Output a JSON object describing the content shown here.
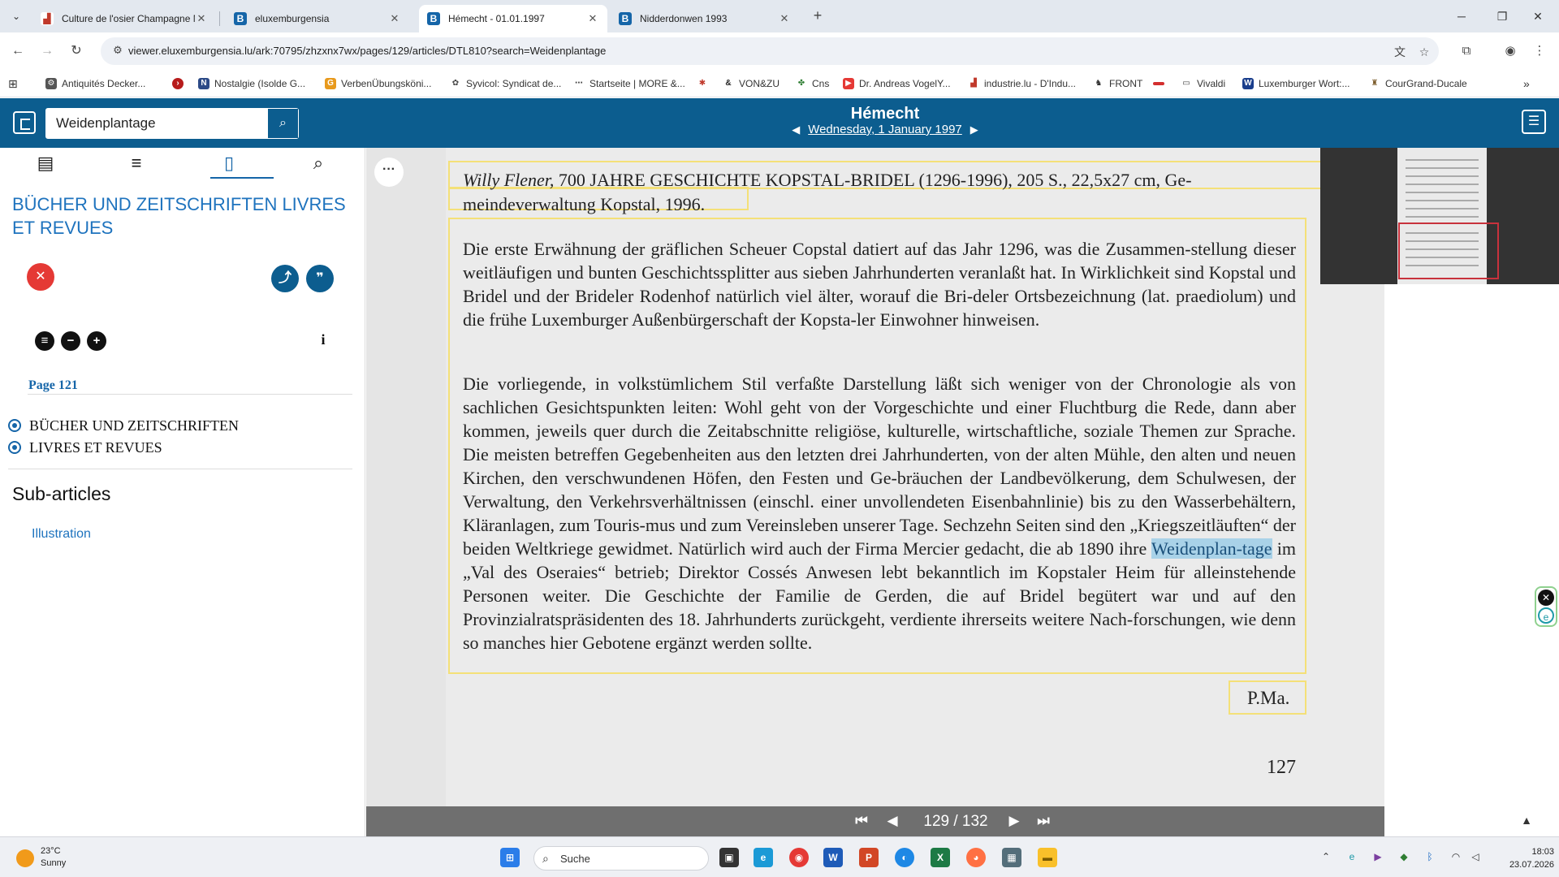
{
  "browser": {
    "tabs": [
      {
        "title": "Culture de l'osier Champagne M",
        "active": false
      },
      {
        "title": "eluxemburgensia",
        "active": false
      },
      {
        "title": "Hémecht - 01.01.1997",
        "active": true
      },
      {
        "title": "Nidderdonwen 1993",
        "active": false
      }
    ],
    "url": "viewer.eluxemburgensia.lu/ark:70795/zhzxnx7wx/pages/129/articles/DTL810?search=Weidenplantage",
    "bookmarks": [
      "Antiquités Decker...",
      "Nostalgie (Isolde G...",
      "VerbenÜbungsköni...",
      "Syvicol: Syndicat de...",
      "Startseite | MORE &...",
      "VON&ZU",
      "Cns",
      "Dr. Andreas VogelY...",
      "industrie.lu - D'Indu...",
      "FRONT",
      "Vivaldi",
      "Luxemburger Wort:...",
      "CourGrand-Ducale"
    ]
  },
  "header": {
    "search_value": "Weidenplantage",
    "paper_title": "Hémecht",
    "date": "Wednesday, 1 January 1997"
  },
  "sidebar": {
    "article_title": "BÜCHER UND ZEITSCHRIFTEN LIVRES ET REVUES",
    "page_label": "Page 121",
    "sections": [
      "BÜCHER UND ZEITSCHRIFTEN",
      "LIVRES ET REVUES"
    ],
    "subarticles_heading": "Sub-articles",
    "subarticles": [
      "Illustration"
    ]
  },
  "page": {
    "biblio_author": "Willy Flener,",
    "biblio_rest_line1": " 700 JAHRE GESCHICHTE KOPSTAL-BRIDEL (1296-1996), 205 S., 22,5x27 cm, Ge-",
    "biblio_line2": "meindeverwaltung Kopstal, 1996.",
    "para1": "Die erste Erwähnung der gräflichen Scheuer Copstal datiert auf das Jahr 1296, was die Zusammen-stellung dieser weitläufigen und bunten Geschichtssplitter aus sieben Jahrhunderten veranlaßt hat. In Wirklichkeit sind Kopstal und Bridel und der Brideler Rodenhof natürlich viel älter, worauf die Bri-deler Ortsbezeichnung (lat. praediolum) und die frühe Luxemburger Außenbürgerschaft der Kopsta-ler Einwohner hinweisen.",
    "para2_before": "Die vorliegende, in volkstümlichem Stil verfaßte Darstellung läßt sich weniger von der Chronologie als von sachlichen Gesichtspunkten leiten: Wohl geht von der Vorgeschichte und einer Fluchtburg die Rede, dann aber kommen, jeweils quer durch die Zeitabschnitte religiöse, kulturelle, wirtschaftliche, soziale Themen zur Sprache. Die meisten betreffen Gegebenheiten aus den letzten drei Jahrhunderten, von der alten Mühle, den alten und neuen Kirchen, den verschwundenen Höfen, den Festen und Ge-bräuchen der Landbevölkerung, dem Schulwesen, der Verwaltung, den Verkehrsverhältnissen (einschl. einer unvollendeten Eisenbahnlinie) bis zu den Wasserbehältern, Kläranlagen, zum Touris-mus und zum Vereinsleben unserer Tage. Sechzehn Seiten sind den „Kriegszeitläuften“ der beiden Weltkriege gewidmet. Natürlich wird auch der Firma Mercier gedacht, die ab 1890 ihre ",
    "para2_mark": "Weidenplan-tage",
    "para2_after": " im „Val des Oseraies“ betrieb; Direktor Cossés Anwesen lebt bekanntlich im Kopstaler Heim für alleinstehende Personen weiter. Die Geschichte der Familie de Gerden, die auf Bridel begütert war und auf den Provinzialratspräsidenten des 18. Jahrhunderts zurückgeht, verdiente ihrerseits weitere Nach-forschungen, wie denn so manches hier Gebotene ergänzt werden sollte.",
    "signature": "P.Ma.",
    "page_number": "127"
  },
  "pager": {
    "current": "129 / 132"
  },
  "taskbar": {
    "temp": "23°C",
    "weather": "Sunny",
    "search": "Suche",
    "time": "18:03",
    "date": "23.07.2026"
  },
  "colors": {
    "header_blue": "#0c5d8f",
    "link_blue": "#1e73be",
    "highlight": "#a9d2e8",
    "article_frame": "#f4e078"
  }
}
